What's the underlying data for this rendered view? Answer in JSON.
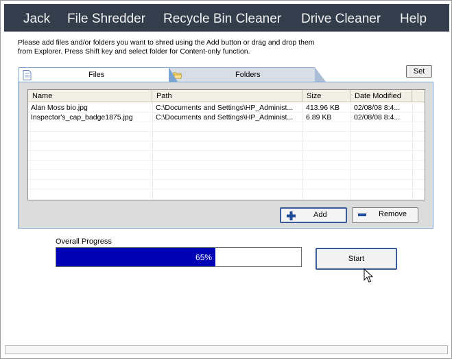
{
  "menu": {
    "items": [
      "Jack",
      "File Shredder",
      "Recycle Bin Cleaner",
      "Drive Cleaner",
      "Help"
    ]
  },
  "instructions": {
    "line1": "Please add files and/or folders you want to shred using the Add button or drag and drop them",
    "line2": "from Explorer. Press Shift key and select folder for Content-only function."
  },
  "tabs": {
    "files_label": "Files",
    "folders_label": "Folders",
    "files_icon": "document-icon",
    "folders_icon": "folder-icon"
  },
  "set_button": "Set",
  "file_list": {
    "columns": [
      "Name",
      "Path",
      "Size",
      "Date Modified"
    ],
    "rows": [
      [
        "Alan Moss bio.jpg",
        "C:\\Documents and Settings\\HP_Administ...",
        "413.96 KB",
        "02/08/08 8:4..."
      ],
      [
        "Inspector's_cap_badge1875.jpg",
        "C:\\Documents and Settings\\HP_Administ...",
        "6.89 KB",
        "02/08/08 8:4..."
      ]
    ]
  },
  "buttons": {
    "add": "Add",
    "remove": "Remove",
    "start": "Start"
  },
  "progress": {
    "label": "Overall Progress",
    "value_text": "65%",
    "fraction": 0.65,
    "fill_color": "#0000b4"
  },
  "colors": {
    "menubar": "#333d4b",
    "tab_border": "#7aa4d4"
  }
}
